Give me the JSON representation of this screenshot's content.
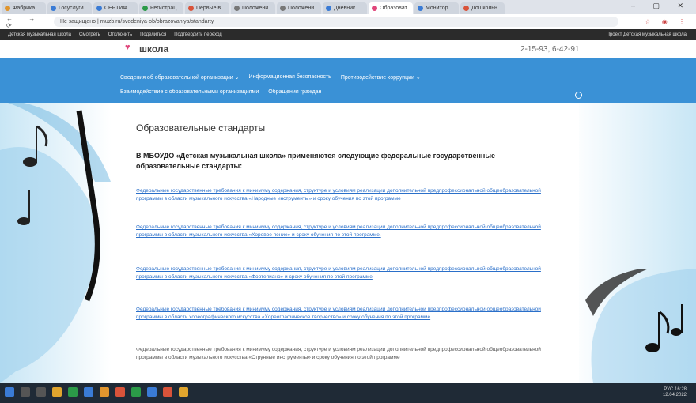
{
  "browser": {
    "tabs": [
      {
        "label": "Фабрика",
        "color": "#e0952e"
      },
      {
        "label": "Госуслуги",
        "color": "#3a7bd5"
      },
      {
        "label": "СЕРТИФ",
        "color": "#3a7bd5"
      },
      {
        "label": "Регистрац",
        "color": "#2b9a48"
      },
      {
        "label": "Первые в",
        "color": "#d9533a"
      },
      {
        "label": "Положени",
        "color": "#777777"
      },
      {
        "label": "Положени",
        "color": "#777777"
      },
      {
        "label": "Дневник",
        "color": "#3a7bd5"
      },
      {
        "label": "Образоват",
        "color": "#e0467b"
      },
      {
        "label": "Монитор",
        "color": "#3a7bd5"
      },
      {
        "label": "Дошкольн",
        "color": "#d9533a"
      }
    ],
    "active_tab_index": 8,
    "url": "Не защищено | rnuzb.ru/svedeniya-ob/obrazovaniya/standarty",
    "bookmarks": [
      "Детская музыкальная школа",
      "Смотреть",
      "Отключить",
      "Поделиться",
      "Подтвердить переход"
    ],
    "bookmark_right": "Проект Детская музыкальная школа"
  },
  "site": {
    "logo_text": "школа",
    "phone": "2-15-93, 6-42-91",
    "nav_row1": [
      "Сведения об образовательной организации ⌄",
      "Информационная безопасность",
      "Противодействие коррупции ⌄"
    ],
    "nav_row2": [
      "Взаимодействие с образовательными организациями",
      "Обращения граждан"
    ]
  },
  "page": {
    "title": "Образовательные стандарты",
    "intro": "В МБОУДО «Детская музыкальная школа» применяются следующие федеральные государственные образовательные стандарты:",
    "docs": [
      {
        "text": "Федеральные государственные требования к минимуму содержания, структуре и условиям реализации дополнительной предпрофессиональной общеобразовательной программы в области музыкального искусства «Народные инструменты» и сроку обучения по этой программе",
        "link": true
      },
      {
        "text": "Федеральные государственные требования к минимуму содержания, структуре и условиям реализации дополнительной предпрофессиональной общеобразовательной программы в области музыкального искусства «Хоровое пение» и сроку обучения по этой программе.",
        "link": true
      },
      {
        "text": "Федеральные государственные требования к минимуму содержания, структуре и условиям реализации дополнительной предпрофессиональной общеобразовательной программы в области музыкального искусства «Фортепиано» и сроку обучения по этой программе",
        "link": true
      },
      {
        "text": "Федеральные государственные требования к минимуму содержания, структуре и условиям реализации дополнительной предпрофессиональной общеобразовательной программы в области хореографического искусства «Хореографическое творчество» и сроку обучения по этой программе",
        "link": true
      },
      {
        "text": "Федеральные государственные требования к минимуму содержания, структуре и условиям реализации дополнительной предпрофессиональной общеобразовательной программы в области музыкального искусства «Струнные инструменты» и сроку обучения по этой программе",
        "link": false
      }
    ]
  },
  "taskbar": {
    "time": "16:28",
    "date": "12.04.2022",
    "lang": "РУС"
  }
}
